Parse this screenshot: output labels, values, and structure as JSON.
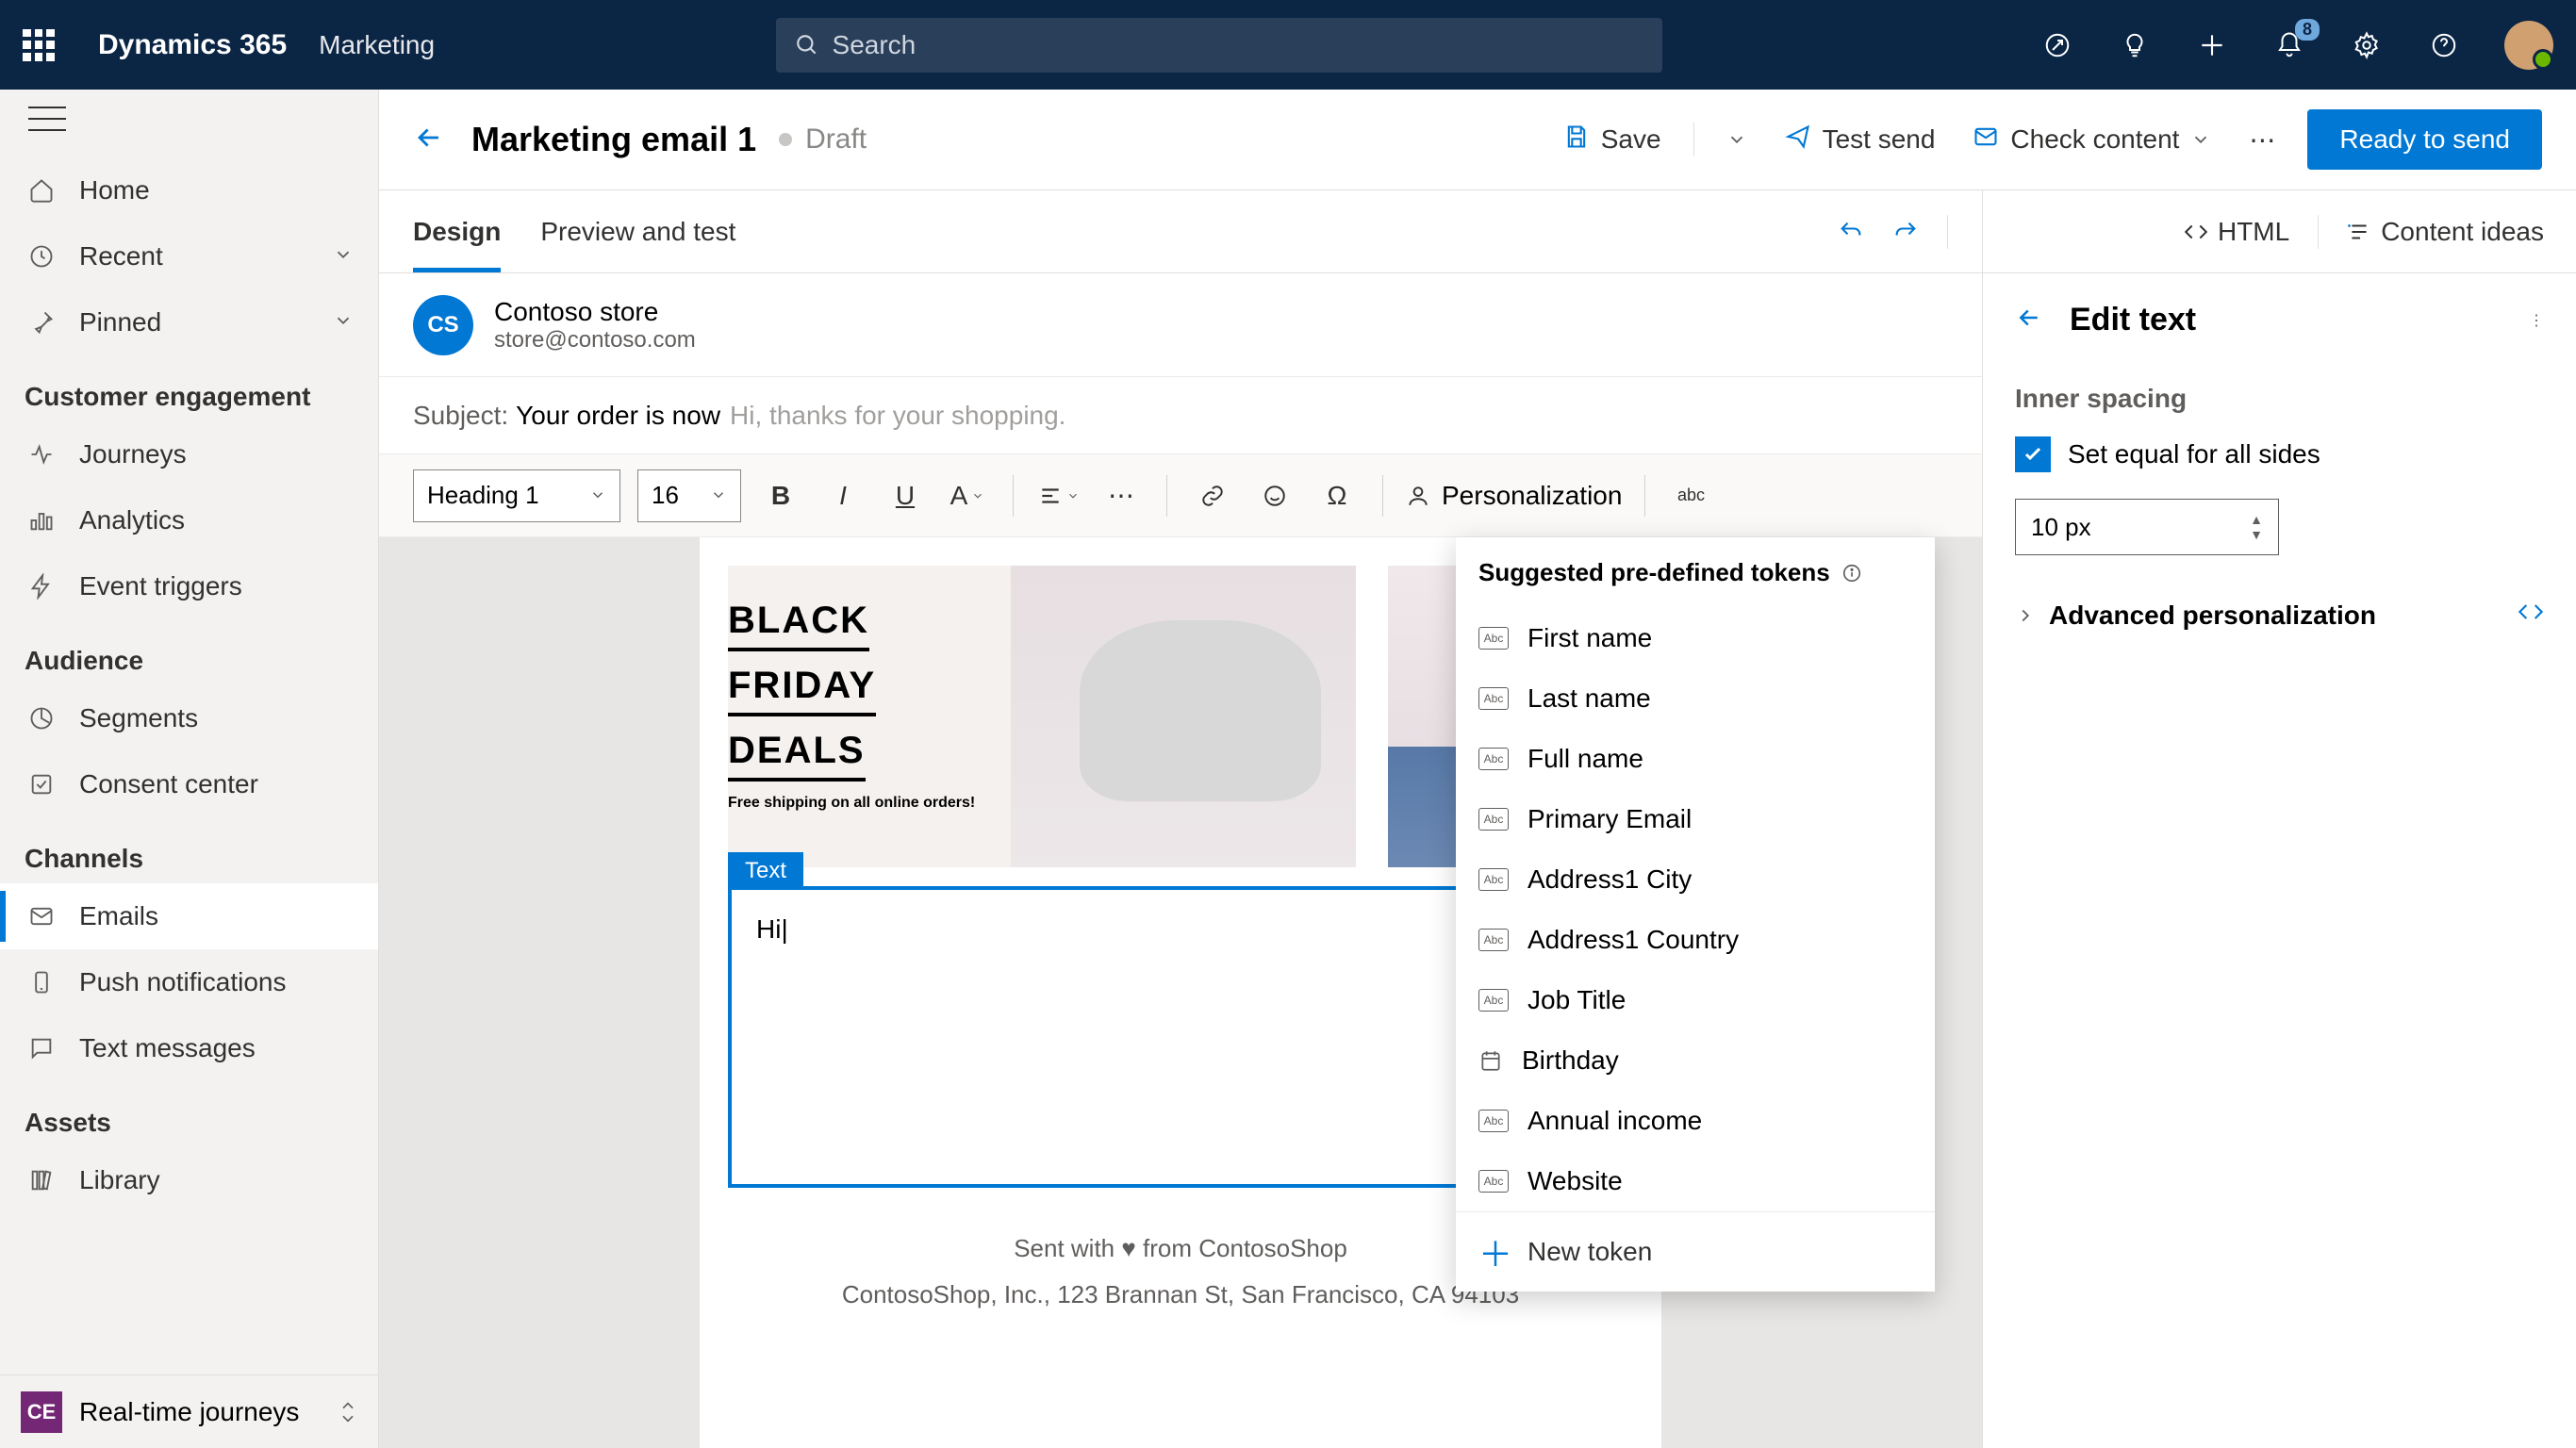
{
  "top": {
    "brand": "Dynamics 365",
    "module": "Marketing",
    "search_placeholder": "Search",
    "badge": "8"
  },
  "nav": {
    "home": "Home",
    "recent": "Recent",
    "pinned": "Pinned",
    "sections": {
      "engagement": "Customer engagement",
      "audience": "Audience",
      "channels": "Channels",
      "assets": "Assets"
    },
    "items": {
      "journeys": "Journeys",
      "analytics": "Analytics",
      "event_triggers": "Event triggers",
      "segments": "Segments",
      "consent": "Consent center",
      "emails": "Emails",
      "push": "Push notifications",
      "text": "Text messages",
      "library": "Library"
    },
    "footer_badge": "CE",
    "footer_label": "Real-time journeys"
  },
  "cmd": {
    "title": "Marketing email 1",
    "status": "Draft",
    "save": "Save",
    "test_send": "Test send",
    "check": "Check content",
    "ready": "Ready to send"
  },
  "tabs": {
    "design": "Design",
    "preview": "Preview and test"
  },
  "tabright": {
    "html": "HTML",
    "ideas": "Content ideas"
  },
  "sender": {
    "initials": "CS",
    "name": "Contoso store",
    "email": "store@contoso.com"
  },
  "subject": {
    "label": "Subject:",
    "value": "Your order is now",
    "hint": "Hi, thanks for your shopping."
  },
  "toolbar": {
    "heading": "Heading 1",
    "size": "16",
    "personalization": "Personalization"
  },
  "canvas": {
    "hero": {
      "l1": "BLACK",
      "l2": "FRIDAY",
      "l3": "DEALS",
      "ship": "Free shipping on all online orders!"
    },
    "text_tag": "Text",
    "text_body": "Hi|",
    "footer1": "Sent with ♥ from ContosoShop",
    "footer2": "ContosoShop, Inc., 123 Brannan St, San Francisco, CA 94103"
  },
  "tokens": {
    "header": "Suggested pre-defined tokens",
    "list": [
      "First name",
      "Last name",
      "Full name",
      "Primary Email",
      "Address1 City",
      "Address1 Country",
      "Job Title",
      "Birthday",
      "Annual income",
      "Website"
    ],
    "new": "New token"
  },
  "right": {
    "title": "Edit text",
    "spacing_label": "Inner spacing",
    "equal": "Set equal for all sides",
    "value": "10 px",
    "adv": "Advanced personalization"
  }
}
